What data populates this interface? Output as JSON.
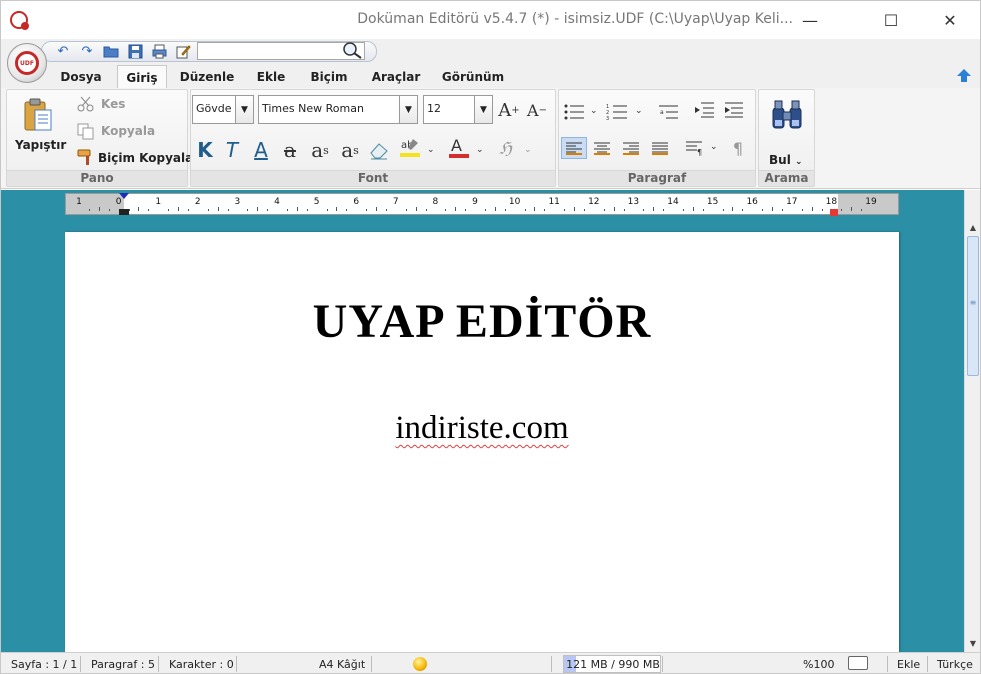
{
  "window": {
    "title": "Doküman Editörü v5.4.7 (*) - isimsiz.UDF (C:\\Uyap\\Uyap Keli...",
    "minimize_glyph": "—",
    "maximize_glyph": "☐",
    "close_glyph": "✕"
  },
  "logo": {
    "text": "UDF"
  },
  "quick_access": {
    "search_value": "",
    "icons": [
      "undo-icon",
      "redo-icon",
      "open-folder-icon",
      "save-icon",
      "print-icon",
      "edit-icon"
    ]
  },
  "tabs": [
    {
      "label": "Dosya"
    },
    {
      "label": "Giriş"
    },
    {
      "label": "Düzenle"
    },
    {
      "label": "Ekle"
    },
    {
      "label": "Biçim"
    },
    {
      "label": "Araçlar"
    },
    {
      "label": "Görünüm"
    }
  ],
  "active_tab": "Giriş",
  "ribbon": {
    "pano": {
      "label": "Pano",
      "paste": "Yapıştır",
      "cut": "Kes",
      "copy": "Kopyala",
      "format_painter": "Biçim Kopyala"
    },
    "font": {
      "label": "Font",
      "style_value": "Gövde",
      "font_value": "Times New Roman",
      "size_value": "12",
      "bold": "K",
      "italic": "T",
      "underline": "A",
      "strike": "a",
      "subscript": "a",
      "superscript": "a"
    },
    "paragraf": {
      "label": "Paragraf"
    },
    "arama": {
      "label": "Arama",
      "find": "Bul"
    }
  },
  "ruler": {
    "numbers": [
      "1",
      "0",
      "1",
      "2",
      "3",
      "4",
      "5",
      "6",
      "7",
      "8",
      "9",
      "10",
      "11",
      "12",
      "13",
      "14",
      "15",
      "16",
      "17",
      "18",
      "19"
    ]
  },
  "document": {
    "heading": "UYAP EDİTÖR",
    "text": "indiriste.com"
  },
  "status": {
    "page": "Sayfa : 1 / 1",
    "paragraph": "Paragraf : 5",
    "characters": "Karakter : 0",
    "paper": "A4 Kâğıt",
    "memory": "121 MB / 990 MB",
    "memory_fraction": 0.122,
    "zoom": "%100",
    "mode": "Ekle",
    "language": "Türkçe"
  }
}
